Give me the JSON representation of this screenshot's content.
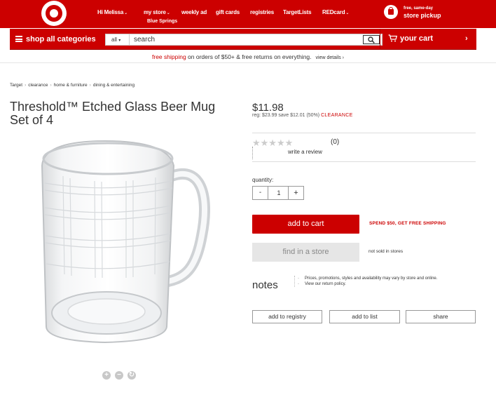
{
  "header": {
    "greeting": "Hi Melissa",
    "my_store": "my store",
    "store_name": "Blue Springs",
    "weekly_ad": "weekly ad",
    "gift_cards": "gift cards",
    "registries": "registries",
    "target_lists": "TargetLists",
    "redcard": "REDcard",
    "pickup_small": "free, same-day",
    "pickup_big": "store pickup",
    "brand_color": "#cc0000"
  },
  "catbar": {
    "shop_all": "shop all categories",
    "search_dropdown": "all",
    "search_placeholder": "search",
    "cart": "your cart",
    "chevron": "›"
  },
  "shipping": {
    "free_shipping": "free shipping",
    "message": " on orders of $50+ & free returns on everything.",
    "details": "view details ›"
  },
  "breadcrumb": [
    "Target",
    "clearance",
    "home & furniture",
    "dining & entertaining"
  ],
  "product": {
    "title": "Threshold™ Etched Glass Beer Mug Set of 4",
    "price": "$11.98",
    "reg_text": "reg: $23.99  save $12.01 (50%)",
    "clearance": "CLEARANCE",
    "stars_icon": "★★★★★",
    "rating": 0,
    "review_count": "(0)",
    "write_review": "write a review",
    "quantity_label": "quantity:",
    "quantity_minus": "-",
    "quantity_value": "1",
    "quantity_plus": "+",
    "add_to_cart": "add to cart",
    "spend_msg": "SPEND $50, GET FREE SHIPPING",
    "find_store": "find in a store",
    "not_sold": "not sold in stores",
    "notes_label": "notes",
    "notes": [
      "Prices, promotions, styles and availability may vary by store and online.",
      "View our return policy."
    ],
    "add_to_registry": "add to registry",
    "add_to_list": "add to list",
    "share": "share",
    "zoom_in": "+",
    "zoom_out": "−",
    "reset": "↻"
  }
}
